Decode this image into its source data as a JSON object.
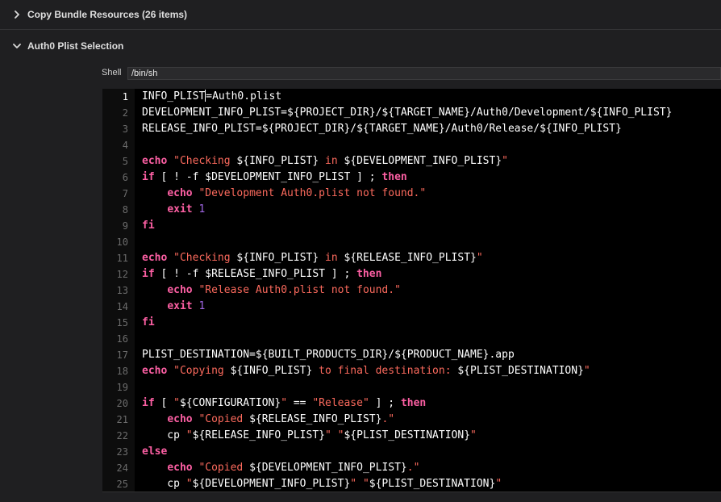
{
  "phases": {
    "copy_bundle": {
      "title": "Copy Bundle Resources (26 items)",
      "expanded": false
    },
    "auth0": {
      "title": "Auth0 Plist Selection",
      "expanded": true
    }
  },
  "shell": {
    "label": "Shell",
    "value": "/bin/sh"
  },
  "colors": {
    "keyword": "#fc5fa3",
    "string": "#fc6a5d",
    "number": "#a167e6",
    "plain": "#ffffff",
    "background": "#000000"
  },
  "script": {
    "active_line": 1,
    "lines": [
      [
        [
          "p",
          "INFO_PLIST"
        ],
        [
          "cursor",
          ""
        ],
        [
          "p",
          "=Auth0.plist"
        ]
      ],
      [
        [
          "p",
          "DEVELOPMENT_INFO_PLIST=${PROJECT_DIR}/${TARGET_NAME}/Auth0/Development/${INFO_PLIST}"
        ]
      ],
      [
        [
          "p",
          "RELEASE_INFO_PLIST=${PROJECT_DIR}/${TARGET_NAME}/Auth0/Release/${INFO_PLIST}"
        ]
      ],
      [],
      [
        [
          "k",
          "echo"
        ],
        [
          "p",
          " "
        ],
        [
          "s",
          "\"Checking "
        ],
        [
          "p",
          "${INFO_PLIST}"
        ],
        [
          "s",
          " in "
        ],
        [
          "p",
          "${DEVELOPMENT_INFO_PLIST}"
        ],
        [
          "s",
          "\""
        ]
      ],
      [
        [
          "k",
          "if"
        ],
        [
          "p",
          " [ ! -f $DEVELOPMENT_INFO_PLIST ] ; "
        ],
        [
          "k",
          "then"
        ]
      ],
      [
        [
          "p",
          "    "
        ],
        [
          "k",
          "echo"
        ],
        [
          "p",
          " "
        ],
        [
          "s",
          "\"Development Auth0.plist not found.\""
        ]
      ],
      [
        [
          "p",
          "    "
        ],
        [
          "k",
          "exit"
        ],
        [
          "p",
          " "
        ],
        [
          "n",
          "1"
        ]
      ],
      [
        [
          "k",
          "fi"
        ]
      ],
      [],
      [
        [
          "k",
          "echo"
        ],
        [
          "p",
          " "
        ],
        [
          "s",
          "\"Checking "
        ],
        [
          "p",
          "${INFO_PLIST}"
        ],
        [
          "s",
          " in "
        ],
        [
          "p",
          "${RELEASE_INFO_PLIST}"
        ],
        [
          "s",
          "\""
        ]
      ],
      [
        [
          "k",
          "if"
        ],
        [
          "p",
          " [ ! -f $RELEASE_INFO_PLIST ] ; "
        ],
        [
          "k",
          "then"
        ]
      ],
      [
        [
          "p",
          "    "
        ],
        [
          "k",
          "echo"
        ],
        [
          "p",
          " "
        ],
        [
          "s",
          "\"Release Auth0.plist not found.\""
        ]
      ],
      [
        [
          "p",
          "    "
        ],
        [
          "k",
          "exit"
        ],
        [
          "p",
          " "
        ],
        [
          "n",
          "1"
        ]
      ],
      [
        [
          "k",
          "fi"
        ]
      ],
      [],
      [
        [
          "p",
          "PLIST_DESTINATION=${BUILT_PRODUCTS_DIR}/${PRODUCT_NAME}.app"
        ]
      ],
      [
        [
          "k",
          "echo"
        ],
        [
          "p",
          " "
        ],
        [
          "s",
          "\"Copying "
        ],
        [
          "p",
          "${INFO_PLIST}"
        ],
        [
          "s",
          " to final destination: "
        ],
        [
          "p",
          "${PLIST_DESTINATION}"
        ],
        [
          "s",
          "\""
        ]
      ],
      [],
      [
        [
          "k",
          "if"
        ],
        [
          "p",
          " [ "
        ],
        [
          "s",
          "\""
        ],
        [
          "p",
          "${CONFIGURATION}"
        ],
        [
          "s",
          "\""
        ],
        [
          "p",
          " == "
        ],
        [
          "s",
          "\"Release\""
        ],
        [
          "p",
          " ] ; "
        ],
        [
          "k",
          "then"
        ]
      ],
      [
        [
          "p",
          "    "
        ],
        [
          "k",
          "echo"
        ],
        [
          "p",
          " "
        ],
        [
          "s",
          "\"Copied "
        ],
        [
          "p",
          "${RELEASE_INFO_PLIST}"
        ],
        [
          "s",
          ".\""
        ]
      ],
      [
        [
          "p",
          "    cp "
        ],
        [
          "s",
          "\""
        ],
        [
          "p",
          "${RELEASE_INFO_PLIST}"
        ],
        [
          "s",
          "\""
        ],
        [
          "p",
          " "
        ],
        [
          "s",
          "\""
        ],
        [
          "p",
          "${PLIST_DESTINATION}"
        ],
        [
          "s",
          "\""
        ]
      ],
      [
        [
          "k",
          "else"
        ]
      ],
      [
        [
          "p",
          "    "
        ],
        [
          "k",
          "echo"
        ],
        [
          "p",
          " "
        ],
        [
          "s",
          "\"Copied "
        ],
        [
          "p",
          "${DEVELOPMENT_INFO_PLIST}"
        ],
        [
          "s",
          ".\""
        ]
      ],
      [
        [
          "p",
          "    cp "
        ],
        [
          "s",
          "\""
        ],
        [
          "p",
          "${DEVELOPMENT_INFO_PLIST}"
        ],
        [
          "s",
          "\""
        ],
        [
          "p",
          " "
        ],
        [
          "s",
          "\""
        ],
        [
          "p",
          "${PLIST_DESTINATION}"
        ],
        [
          "s",
          "\""
        ]
      ]
    ]
  }
}
